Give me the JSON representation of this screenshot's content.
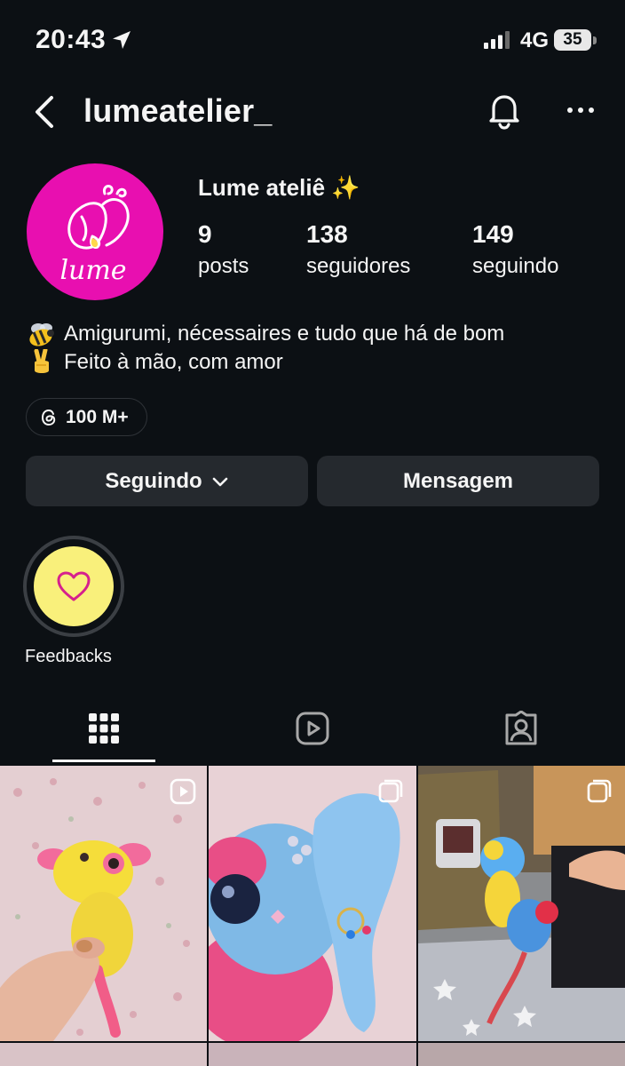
{
  "status_bar": {
    "time": "20:43",
    "network": "4G",
    "battery": "35"
  },
  "header": {
    "username": "lumeatelier_"
  },
  "profile": {
    "display_name": "Lume ateliê ✨",
    "avatar_text": "lume",
    "stats": [
      {
        "value": "9",
        "label": "posts"
      },
      {
        "value": "138",
        "label": "seguidores"
      },
      {
        "value": "149",
        "label": "seguindo"
      }
    ],
    "bio": [
      {
        "icon": "bee-icon",
        "text": "Amigurumi, nécessaires e tudo que há de bom"
      },
      {
        "icon": "victory-hand-icon",
        "text": "Feito à mão, com amor"
      }
    ],
    "threads_badge": "100 M+"
  },
  "actions": {
    "following": "Seguindo",
    "message": "Mensagem"
  },
  "highlights": [
    {
      "label": "Feedbacks",
      "icon": "heart-icon"
    }
  ],
  "tabs": [
    {
      "name": "posts-grid",
      "icon": "grid-icon",
      "active": true
    },
    {
      "name": "reels",
      "icon": "reels-icon",
      "active": false
    },
    {
      "name": "tagged",
      "icon": "tagged-icon",
      "active": false
    }
  ],
  "posts": [
    {
      "type": "reel",
      "subject": "yellow crochet axolotl keychain in hand"
    },
    {
      "type": "carousel",
      "subject": "blue plush crochet keychain with earrings"
    },
    {
      "type": "carousel",
      "subject": "crochet keychains on a bag"
    }
  ]
}
